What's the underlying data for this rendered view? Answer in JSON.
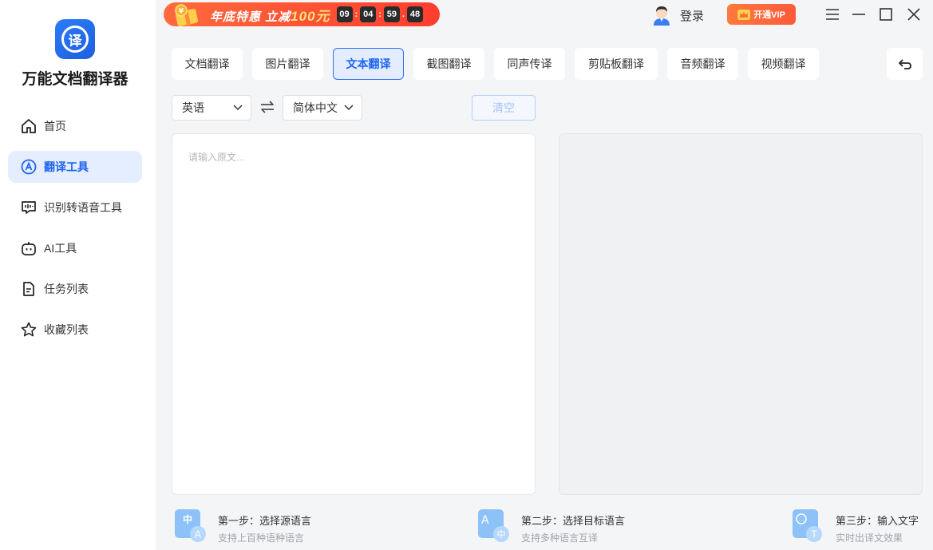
{
  "app": {
    "name": "万能文档翻译器",
    "logo_char": "译"
  },
  "sidebar": {
    "items": [
      {
        "label": "首页",
        "icon": "home-icon"
      },
      {
        "label": "翻译工具",
        "icon": "translate-icon",
        "active": true
      },
      {
        "label": "识别转语音工具",
        "icon": "speech-icon"
      },
      {
        "label": "AI工具",
        "icon": "robot-icon"
      },
      {
        "label": "任务列表",
        "icon": "task-list-icon"
      },
      {
        "label": "收藏列表",
        "icon": "star-icon"
      }
    ]
  },
  "promo": {
    "text_a": "年底特惠 立减",
    "text_b": "100元",
    "timer": [
      "09",
      "04",
      "59",
      "48"
    ]
  },
  "header": {
    "login_label": "登录",
    "vip_label": "开通VIP"
  },
  "tabs": [
    {
      "label": "文档翻译"
    },
    {
      "label": "图片翻译"
    },
    {
      "label": "文本翻译",
      "active": true
    },
    {
      "label": "截图翻译"
    },
    {
      "label": "同声传译"
    },
    {
      "label": "剪贴板翻译"
    },
    {
      "label": "音频翻译"
    },
    {
      "label": "视频翻译"
    }
  ],
  "language": {
    "source": "英语",
    "target": "简体中文",
    "clear_label": "清空"
  },
  "input": {
    "placeholder": "请输入原文...",
    "value": ""
  },
  "steps": [
    {
      "title": "第一步：选择源语言",
      "subtitle": "支持上百种语种语言",
      "icon_main": "中",
      "icon_badge": "A"
    },
    {
      "title": "第二步：选择目标语言",
      "subtitle": "支持多种语言互译",
      "icon_main": "A",
      "icon_badge": "中"
    },
    {
      "title": "第三步：输入文字",
      "subtitle": "实时出译文效果",
      "icon_main": "…",
      "icon_badge": "T"
    }
  ],
  "colors": {
    "accent": "#1d64f2",
    "active_bg": "#e5eeff",
    "promo": "#ff4a2e",
    "vip": "#ff6a3b"
  }
}
